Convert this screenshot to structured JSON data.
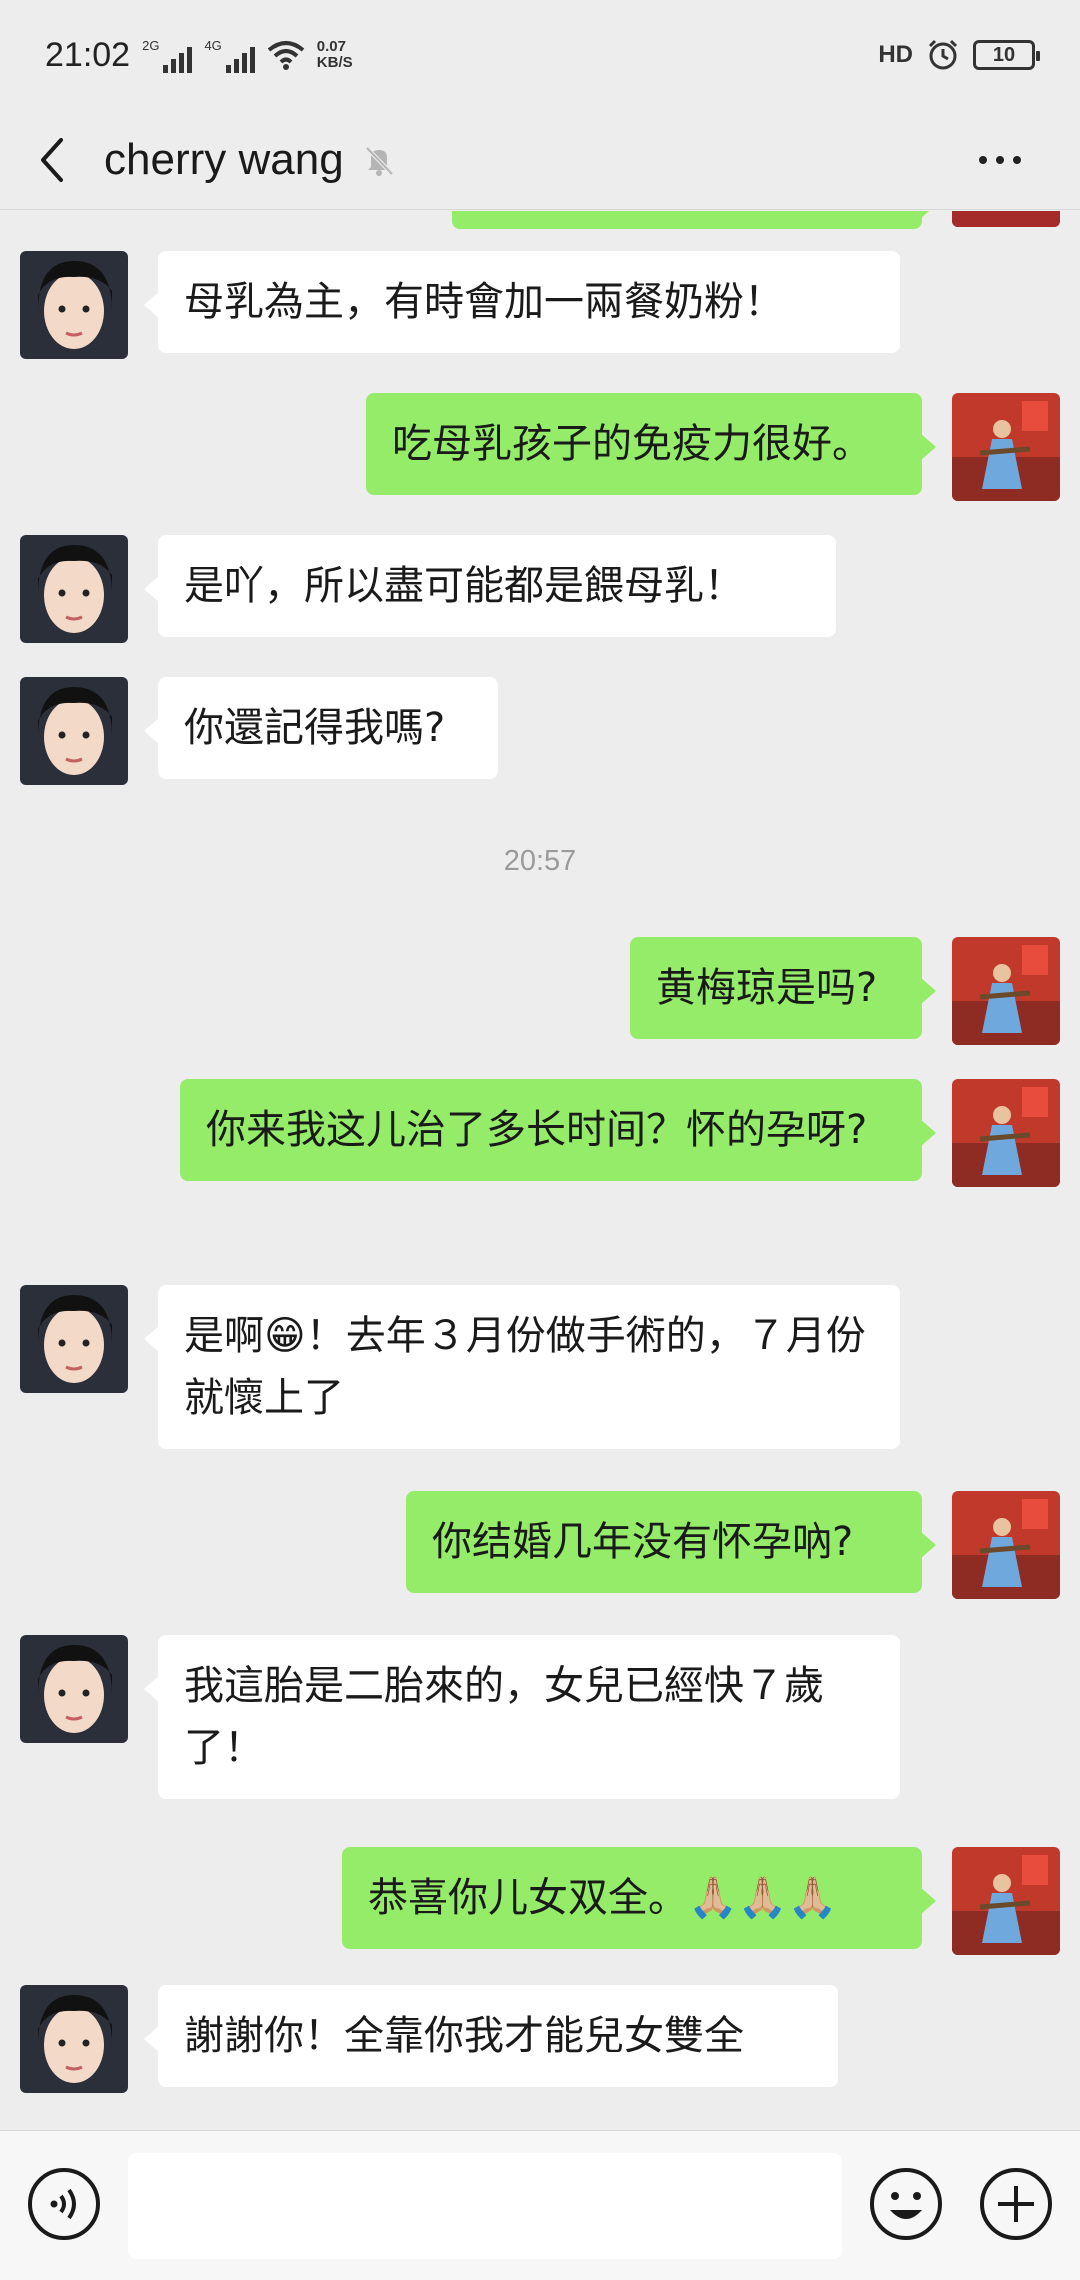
{
  "status_bar": {
    "time": "21:02",
    "net1": "2G",
    "net2": "4G",
    "speed_value": "0.07",
    "speed_unit": "KB/S",
    "hd_label": "HD",
    "battery": "10"
  },
  "header": {
    "title": "cherry wang",
    "back_icon": "chevron-left-icon",
    "mute_icon": "bell-muted-icon",
    "more_icon": "more-horizontal-icon"
  },
  "messages": [
    {
      "side": "in",
      "text": "母乳為主，有時會加一兩餐奶粉！"
    },
    {
      "side": "out",
      "text": "吃母乳孩子的免疫力很好。"
    },
    {
      "side": "in",
      "text": "是吖，所以盡可能都是餵母乳！"
    },
    {
      "side": "in",
      "text": "你還記得我嗎?"
    },
    {
      "side": "out",
      "text": "黄梅琼是吗?"
    },
    {
      "side": "out",
      "text": "你来我这儿治了多长时间？怀的孕呀?"
    },
    {
      "side": "in",
      "text_before": "是啊",
      "emoji": "😁",
      "text_after": "！去年３月份做手術的，７月份就懷上了"
    },
    {
      "side": "out",
      "text": "你结婚几年没有怀孕吶?"
    },
    {
      "side": "in",
      "text": "我這胎是二胎來的，女兒已經快７歲了！"
    },
    {
      "side": "out",
      "text": "恭喜你儿女双全。",
      "emoji": "🙏🏼🙏🏼🙏🏼"
    },
    {
      "side": "in",
      "text": "謝謝你！全靠你我才能兒女雙全"
    }
  ],
  "timestamp": "20:57",
  "input_bar": {
    "voice_icon": "voice-icon",
    "emoji_icon": "smile-emoji-icon",
    "plus_icon": "plus-circle-icon",
    "value": ""
  },
  "colors": {
    "background": "#EDEDED",
    "outgoing_bubble": "#95EC69",
    "incoming_bubble": "#FFFFFF",
    "timestamp": "#9A9A9A"
  }
}
